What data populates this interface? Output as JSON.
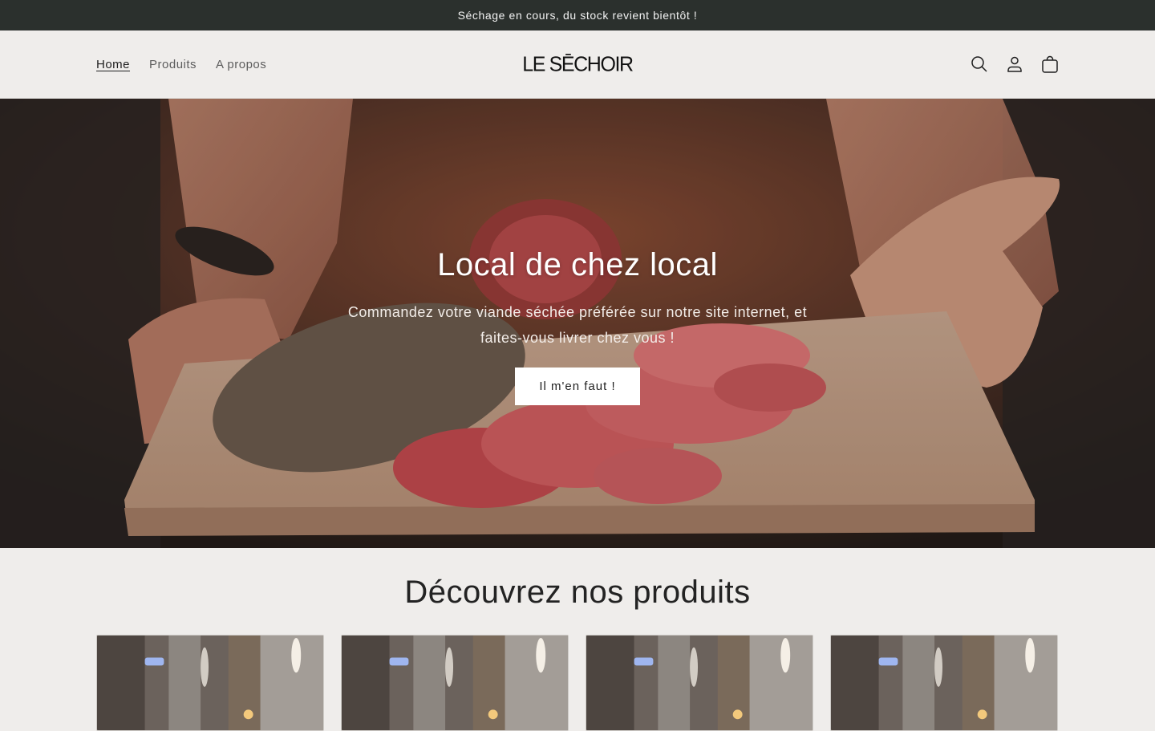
{
  "announcement": {
    "text": "Séchage en cours, du stock revient bientôt !"
  },
  "header": {
    "nav": [
      {
        "label": "Home",
        "active": true
      },
      {
        "label": "Produits",
        "active": false
      },
      {
        "label": "A propos",
        "active": false
      }
    ],
    "logo_text": "LE SĒCHOIR",
    "icons": [
      "search-icon",
      "account-icon",
      "cart-icon"
    ]
  },
  "hero": {
    "title": "Local de chez local",
    "subtitle": "Commandez votre viande séchée préférée sur notre site internet, et faites-vous livrer chez vous !",
    "button_label": "Il m'en faut !"
  },
  "products_section": {
    "title": "Découvrez nos produits",
    "card_count": 4
  },
  "colors": {
    "announcement_bg": "#2b302d",
    "page_bg": "#efedeb",
    "text": "#1f1f1f"
  }
}
